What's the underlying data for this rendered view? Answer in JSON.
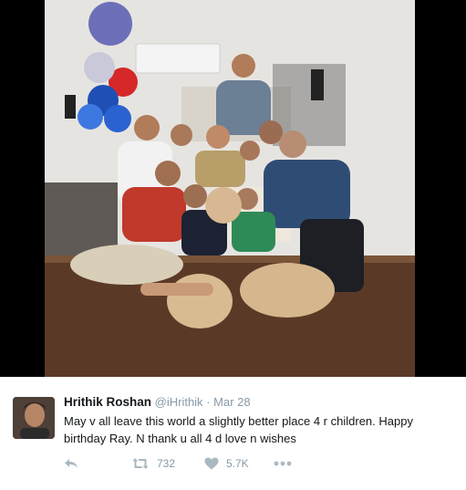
{
  "tweet": {
    "display_name": "Hrithik Roshan",
    "handle": "@iHrithik",
    "separator": "·",
    "date": "Mar 28",
    "text": "May v all leave this world a slightly better place 4 r children. Happy birthday Ray. N thank u all 4 d love n wishes",
    "actions": {
      "reply_icon": "reply-icon",
      "retweet_icon": "retweet-icon",
      "retweet_count": "732",
      "like_icon": "heart-icon",
      "like_count": "5.7K",
      "more_icon": "more-dots-icon"
    }
  },
  "colors": {
    "text_primary": "#14171a",
    "text_secondary": "#8899a6",
    "icon": "#aab8c2",
    "photo_letterbox": "#000000"
  }
}
